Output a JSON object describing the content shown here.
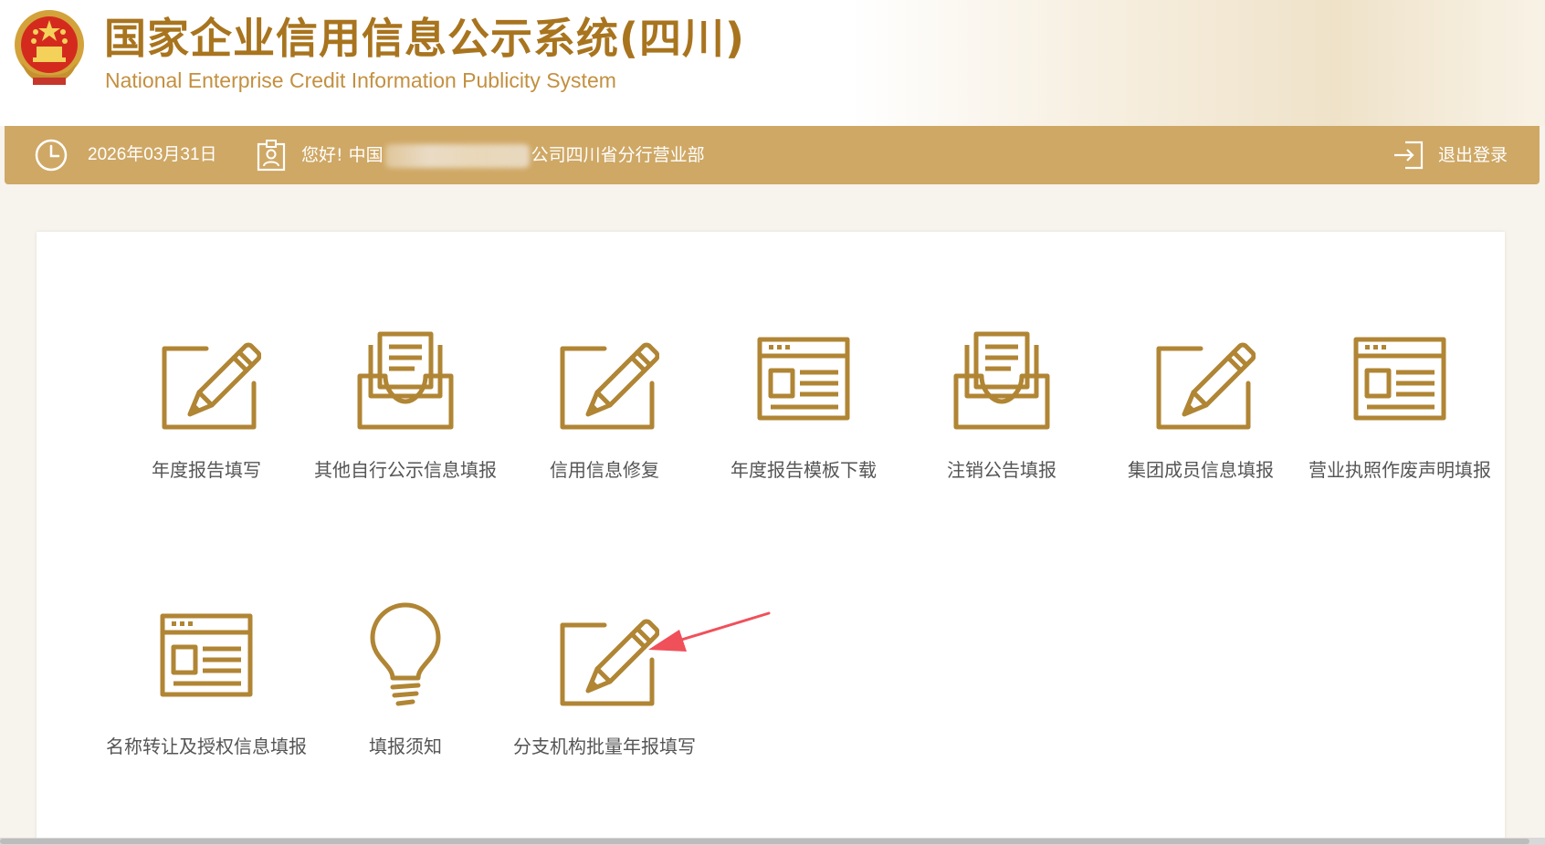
{
  "header": {
    "title_cn": "国家企业信用信息公示系统(四川)",
    "title_en": "National Enterprise Credit Information Publicity System",
    "emblem_icon": "national-emblem-icon"
  },
  "topbar": {
    "date": "2026年03月31日",
    "greeting_prefix": "您好! 中国",
    "greeting_suffix": "公司四川省分行营业部",
    "logout": "退出登录"
  },
  "colors": {
    "gold": "#a8741e",
    "icon_gold": "#b08534",
    "bar": "#cfa865",
    "label": "#555555",
    "arrow": "#f0505a"
  },
  "menu": {
    "items": [
      {
        "label": "年度报告填写",
        "icon": "edit-form-icon"
      },
      {
        "label": "其他自行公示信息填报",
        "icon": "inbox-document-icon"
      },
      {
        "label": "信用信息修复",
        "icon": "edit-form-icon"
      },
      {
        "label": "年度报告模板下载",
        "icon": "template-window-icon"
      },
      {
        "label": "注销公告填报",
        "icon": "inbox-document-icon"
      },
      {
        "label": "集团成员信息填报",
        "icon": "edit-form-icon"
      },
      {
        "label": "营业执照作废声明填报",
        "icon": "template-window-icon"
      },
      {
        "label": "名称转让及授权信息填报",
        "icon": "template-window-icon"
      },
      {
        "label": "填报须知",
        "icon": "lightbulb-icon"
      },
      {
        "label": "分支机构批量年报填写",
        "icon": "edit-form-icon"
      }
    ]
  }
}
